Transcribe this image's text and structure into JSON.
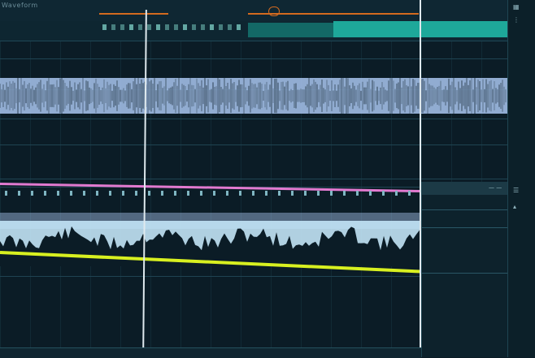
{
  "window": {
    "title": "Waveform"
  },
  "colors": {
    "background": "#0b1c26",
    "teal_region": "#1ea89a",
    "loop_marker": "#d36a1f",
    "automation_pink": "#e27ad0",
    "automation_yellow": "#d8f020",
    "waveform_blue": "#a9c6f0",
    "waveform_lightblue": "#c2e4f6",
    "playhead": "#dfe9ee"
  },
  "icons": {
    "loop_marker": "loop-marker-icon",
    "right_panel": [
      "grid-icon",
      "settings-icon",
      "list-icon",
      "scroll-icon"
    ],
    "inspector_header": "minimize-icon"
  },
  "tracks": [
    {
      "id": "audio-track-1",
      "kind": "audio-waveform"
    },
    {
      "id": "automation-pink",
      "kind": "automation-lane"
    },
    {
      "id": "audio-track-2",
      "kind": "audio-waveform"
    },
    {
      "id": "automation-yellow",
      "kind": "automation-lane"
    }
  ]
}
